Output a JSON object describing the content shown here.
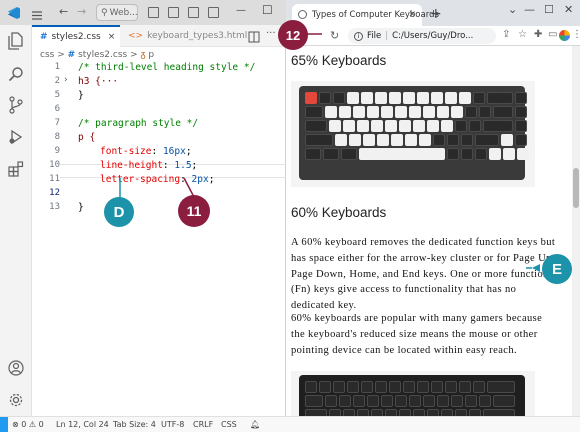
{
  "vscode": {
    "search_text": "Web...",
    "tabs": [
      {
        "icon": "#",
        "label": "styles2.css",
        "close": "×"
      },
      {
        "icon": "<>",
        "label": "keyboard_types3.html"
      }
    ],
    "breadcrumb": {
      "folder": "css",
      "file": "styles2.css",
      "symbol": "p"
    },
    "lines": [
      {
        "n": "1",
        "text": "/* third-level heading style */"
      },
      {
        "n": "2",
        "text": "h3 {···"
      },
      {
        "n": "5",
        "text": "}"
      },
      {
        "n": "6",
        "text": ""
      },
      {
        "n": "7",
        "text": "/* paragraph style */"
      },
      {
        "n": "8",
        "text": "p {"
      },
      {
        "n": "9",
        "prop": "font-size",
        "val": "16px"
      },
      {
        "n": "10",
        "prop": "line-height",
        "val": "1.5"
      },
      {
        "n": "11",
        "prop": "letter-spacing",
        "val": "2px"
      },
      {
        "n": "12",
        "text": ""
      },
      {
        "n": "13",
        "text": "}"
      }
    ],
    "status": {
      "problems": "⊗ 0 ⚠ 0",
      "position": "Ln 12, Col 24",
      "tab_size": "Tab Size: 4",
      "encoding": "UTF-8",
      "eol": "CRLF",
      "language": "CSS"
    }
  },
  "browser": {
    "tab_title": "Types of Computer Keyboards",
    "url_label": "File",
    "url": "C:/Users/Guy/Dro...",
    "headings": [
      "65% Keyboards",
      "60% Keyboards"
    ],
    "paragraphs": [
      "A 60% keyboard removes the dedicated function keys but has space either for the arrow-key cluster or for Page Up, Page Down, Home, and End keys. One or more function (Fn) keys give access to functionality that has no dedicated key.",
      "60% keyboards are popular with many gamers because the keyboard's reduced size means the mouse or other pointing device can be located within easy reach."
    ]
  },
  "callouts": {
    "d": "D",
    "e": "E",
    "eleven": "11",
    "twelve": "12"
  },
  "colors": {
    "teal": "#1c93a8",
    "maroon": "#8b1e3f",
    "vscode_accent": "#005fb8"
  }
}
